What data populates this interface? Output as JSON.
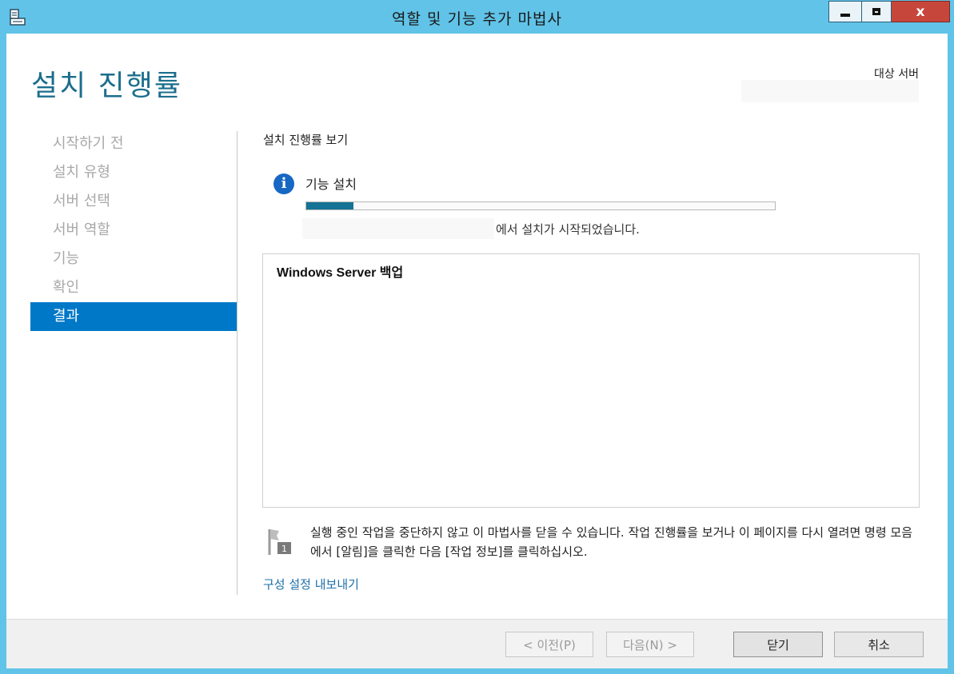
{
  "window": {
    "title": "역할 및 기능 추가 마법사",
    "close_glyph": "x"
  },
  "page": {
    "title": "설치 진행률",
    "target_server_label": "대상 서버",
    "target_server_value": ""
  },
  "nav": {
    "items": [
      {
        "label": "시작하기 전",
        "active": false
      },
      {
        "label": "설치 유형",
        "active": false
      },
      {
        "label": "서버 선택",
        "active": false
      },
      {
        "label": "서버 역할",
        "active": false
      },
      {
        "label": "기능",
        "active": false
      },
      {
        "label": "확인",
        "active": false
      },
      {
        "label": "결과",
        "active": true
      }
    ]
  },
  "progress": {
    "section_title": "설치 진행률 보기",
    "status_label": "기능 설치",
    "percent": 10,
    "note": "에서 설치가 시작되었습니다.",
    "icon": "info-icon"
  },
  "results": {
    "items": [
      "Windows Server 백업"
    ]
  },
  "notice": {
    "text": "실행 중인 작업을 중단하지 않고 이 마법사를 닫을 수 있습니다. 작업 진행률을 보거나 이 페이지를 다시 열려면 명령 모음에서 [알림]을 클릭한 다음 [작업 정보]를 클릭하십시오.",
    "badge": "1",
    "icon": "notification-flag-icon"
  },
  "export_link": "구성 설정 내보내기",
  "footer": {
    "prev_label": "< 이전(P)",
    "next_label": "다음(N) >",
    "close_label": "닫기",
    "cancel_label": "취소"
  },
  "colors": {
    "title_bar": "#61c3e8",
    "accent": "#1c6e8c",
    "nav_active": "#0078c8",
    "progress_fill": "#157395",
    "close_button": "#c7463c",
    "link": "#1d6fa8"
  }
}
